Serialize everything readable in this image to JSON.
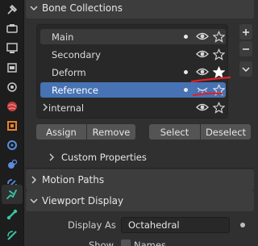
{
  "tabs": [
    {
      "name": "tool-icon",
      "active": false
    },
    {
      "name": "render-icon",
      "active": false
    },
    {
      "name": "output-icon",
      "active": false
    },
    {
      "name": "view-layer-icon",
      "active": false
    },
    {
      "name": "scene-icon",
      "active": false
    },
    {
      "name": "world-icon",
      "active": false
    },
    {
      "name": "object-icon",
      "active": false
    },
    {
      "name": "modifier-icon",
      "active": false
    },
    {
      "name": "physics-icon",
      "active": false
    },
    {
      "name": "constraint-icon",
      "active": false
    },
    {
      "name": "armature-data-icon",
      "active": true
    },
    {
      "name": "bone-icon",
      "active": false
    },
    {
      "name": "bone-constraint-icon",
      "active": false
    }
  ],
  "bone_collections": {
    "title": "Bone Collections",
    "items": [
      {
        "label": "Main",
        "dot": true,
        "visible": true,
        "solo": false
      },
      {
        "label": "Secondary",
        "dot": false,
        "visible": true,
        "solo": false
      },
      {
        "label": "Deform",
        "dot": true,
        "visible": true,
        "solo": true
      },
      {
        "label": "Reference",
        "dot": true,
        "visible": false,
        "solo": false,
        "selected": true
      },
      {
        "label": "internal",
        "dot": false,
        "visible": true,
        "solo": false,
        "expandable": true
      }
    ],
    "side_buttons": [
      "add-icon",
      "remove-icon",
      "dropdown-icon"
    ],
    "buttons": {
      "assign": "Assign",
      "remove": "Remove",
      "select": "Select",
      "deselect": "Deselect"
    },
    "custom_properties": "Custom Properties"
  },
  "motion_paths": {
    "title": "Motion Paths"
  },
  "viewport_display": {
    "title": "Viewport Display",
    "display_as_label": "Display As",
    "display_as_value": "Octahedral",
    "show_label": "Show",
    "names_label": "Names"
  },
  "colors": {
    "selected": "#4772b3",
    "annotation": "#e0202a",
    "accent_tab": "#3dc2a5"
  }
}
